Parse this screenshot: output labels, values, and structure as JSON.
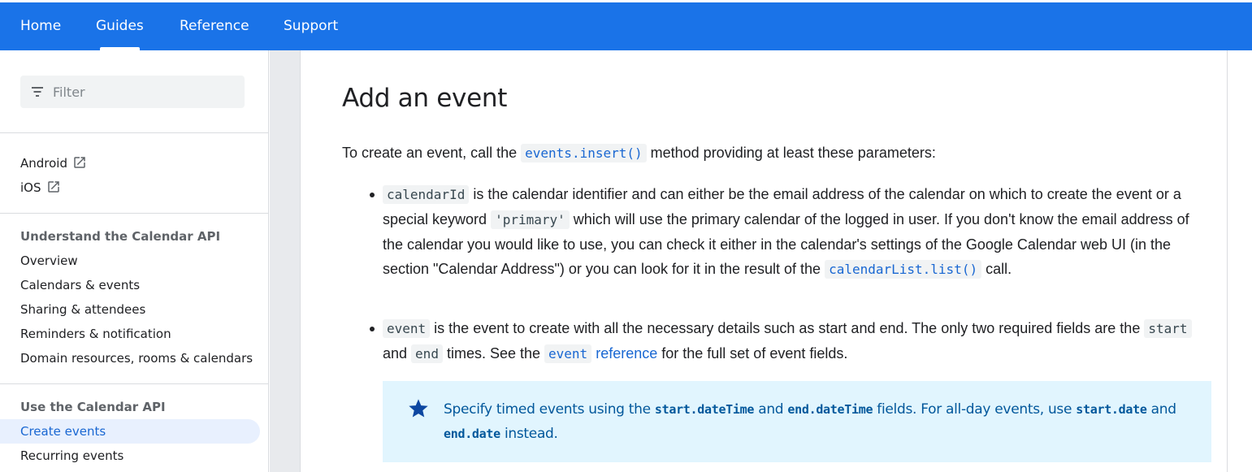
{
  "nav": {
    "tabs": [
      {
        "label": "Home"
      },
      {
        "label": "Guides"
      },
      {
        "label": "Reference"
      },
      {
        "label": "Support"
      }
    ],
    "active": "Guides"
  },
  "sidebar": {
    "filter_placeholder": "Filter",
    "platforms": [
      {
        "label": "Android",
        "icon": "open-in-new-icon"
      },
      {
        "label": "iOS",
        "icon": "open-in-new-icon"
      }
    ],
    "section1": {
      "heading": "Understand the Calendar API",
      "items": [
        "Overview",
        "Calendars & events",
        "Sharing & attendees",
        "Reminders & notification",
        "Domain resources, rooms & calendars"
      ]
    },
    "section2": {
      "heading": "Use the Calendar API",
      "items": [
        "Create events",
        "Recurring events"
      ],
      "active": "Create events"
    }
  },
  "main": {
    "title": "Add an event",
    "intro": {
      "before": "To create an event, call the ",
      "code": "events.insert()",
      "after": " method providing at least these parameters:"
    },
    "bullet1": {
      "code1": "calendarId",
      "text1": " is the calendar identifier and can either be the email address of the calendar on which to create the event or a special keyword ",
      "code2": "'primary'",
      "text2": " which will use the primary calendar of the logged in user. If you don't know the email address of the calendar you would like to use, you can check it either in the calendar's settings of the Google Calendar web UI (in the section \"Calendar Address\") or you can look for it in the result of the ",
      "code3": "calendarList.list()",
      "text3": " call."
    },
    "bullet2": {
      "code1": "event",
      "text1": " is the event to create with all the necessary details such as start and end. The only two required fields are the ",
      "code2": "start",
      "text2": " and ",
      "code3": "end",
      "text3": " times. See the ",
      "code4": "event",
      "link": "reference",
      "text4": " for the full set of event fields."
    },
    "note": {
      "icon": "star-icon",
      "t1": "Specify timed events using the ",
      "c1": "start.dateTime",
      "t2": " and ",
      "c2": "end.dateTime",
      "t3": " fields. For all-day events, use ",
      "c3": "start.date",
      "t4": " and ",
      "c4": "end.date",
      "t5": " instead."
    }
  },
  "colors": {
    "brand_blue": "#1a73e8",
    "link_blue": "#1967d2",
    "note_bg": "#e1f5fe",
    "note_text": "#01579b"
  }
}
